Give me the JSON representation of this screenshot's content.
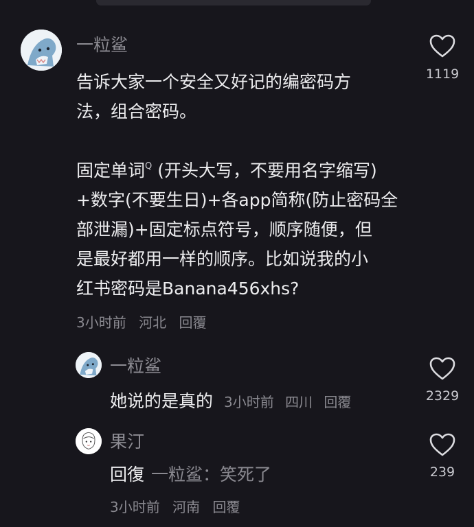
{
  "main_comment": {
    "username": "一粒鲨",
    "lines": [
      "告诉大家一个安全又好记的编密码方",
      "法，组合密码。",
      "",
      "固定单词",
      "+数字(不要生日)+各app简称(防止密码全",
      "部泄漏)+固定标点符号，顺序随便，但",
      "是最好都用一样的顺序。比如说我的小",
      "红书密码是Banana456xhs?"
    ],
    "line4_sup": "Q",
    "line4_rest": " (开头大写，不要用名字缩写)",
    "time": "3小时前",
    "location": "河北",
    "reply_label": "回覆",
    "likes": "1119"
  },
  "replies": [
    {
      "username": "一粒鲨",
      "text": "她说的是真的",
      "time": "3小时前",
      "location": "四川",
      "reply_label": "回覆",
      "likes": "2329"
    },
    {
      "username": "果汀",
      "text_prefix": "回復",
      "target": "一粒鲨：笑死了",
      "time": "3小时前",
      "location": "河南",
      "reply_label": "回覆",
      "likes": "239"
    }
  ],
  "icons": {
    "like": "heart-outline-icon",
    "avatar_shark": "shark-avatar",
    "avatar_girl": "sketch-girl-avatar"
  },
  "colors": {
    "background": "#17161c",
    "text": "#ececee",
    "muted": "#8a8990"
  }
}
